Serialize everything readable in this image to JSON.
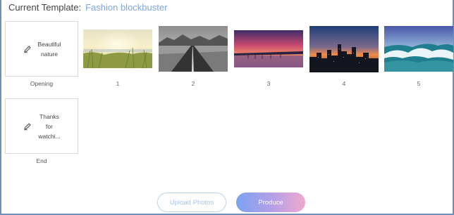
{
  "header": {
    "label": "Current Template:",
    "template_name": "Fashion blockbuster"
  },
  "opening": {
    "text": "Beautiful nature",
    "caption": "Opening",
    "icon": "pencil-icon"
  },
  "end": {
    "text": "Thanks for watchi...",
    "caption": "End",
    "icon": "pencil-icon"
  },
  "photos": [
    {
      "number": "1",
      "subject": "sunset beach grass"
    },
    {
      "number": "2",
      "subject": "black and white desert road"
    },
    {
      "number": "3",
      "subject": "pink sunset over water"
    },
    {
      "number": "4",
      "subject": "city skyline at dusk"
    },
    {
      "number": "5",
      "subject": "ocean wave"
    }
  ],
  "buttons": {
    "upload": "Upload Photos",
    "produce": "Produce"
  },
  "colors": {
    "accent": "#7fa6dc",
    "frame": "#6f8fb8",
    "upload_border": "#b9d3ef"
  }
}
